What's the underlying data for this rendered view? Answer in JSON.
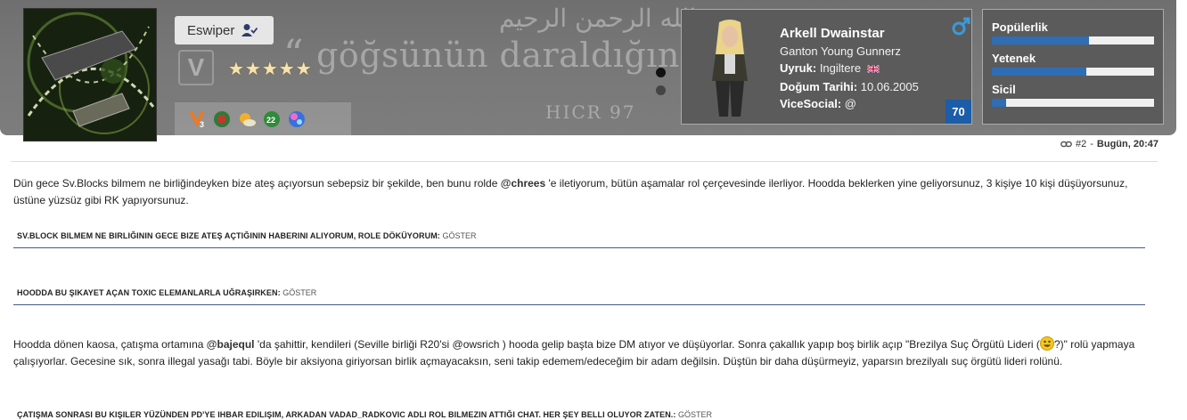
{
  "banner": {
    "quote_text": "göğsünün daraldığını biliyoruz",
    "open_quote": "“",
    "arabic_text": "بسم الله الرحمن الرحيم",
    "verse_ref": "HICR  97",
    "logo_letter": "V"
  },
  "profile": {
    "username": "Eswiper",
    "stars": "★★★★★"
  },
  "character": {
    "name": "Arkell Dwainstar",
    "gang": "Ganton Young Gunnerz",
    "nationality_label": "Uyruk:",
    "nationality_value": "Ingiltere",
    "birth_label": "Doğum Tarihi:",
    "birth_value": "10.06.2005",
    "social_label": "ViceSocial:",
    "social_value": "@",
    "level": "70"
  },
  "stats": [
    {
      "label": "Popülerlik",
      "value": 0.6
    },
    {
      "label": "Yetenek",
      "value": 0.58
    },
    {
      "label": "Sicil",
      "value": 0.09
    }
  ],
  "post_meta": {
    "number": "#2",
    "separator": " - ",
    "time": "Bugün, 20:47"
  },
  "content": {
    "p1_a": "Dün gece Sv.Blocks bilmem ne birliğindeyken bize ateş açıyorsun sebepsiz bir şekilde, ben bunu rolde ",
    "p1_mention": "@chrees",
    "p1_b": " 'e iletiyorum, bütün aşamalar rol çerçevesinde ilerliyor. Hoodda beklerken yine geliyorsunuz, 3 kişiye 10 kişi düşüyorsunuz, üstüne yüzsüz gibi RK yapıyorsunuz.",
    "spoiler1_title": "SV.BLOCK BILMEM NE BIRLIĞININ GECE BIZE ATEŞ AÇTIĞININ HABERINI ALIYORUM, ROLE DÖKÜYORUM:",
    "spoiler2_title": "HOODDA BU ŞIKAYET AÇAN TOXIC ELEMANLARLA UĞRAŞIRKEN:",
    "spoiler_toggle": "GÖSTER",
    "p2_a": "Hoodda dönen kaosa, çatışma ortamına ",
    "p2_mention": "@bajequl",
    "p2_b": " 'da şahittir, kendileri (Seville birliği R20'si @owsrich ) hooda gelip başta bize DM atıyor ve düşüyorlar. Sonra çakallık yapıp boş birlik açıp \"Brezilya Suç Örgütü Lideri (",
    "p2_c": "?)\" rolü yapmaya çalışıyorlar. Gecesine sık, sonra illegal yasağı tabi. Böyle bir aksiyona giriyorsan birlik açmayacaksın, seni takip edemem/edeceğim bir adam değilsin. Düştün bir daha düşürmeyiz, yaparsın brezilyalı suç örgütü lideri rolünü.",
    "spoiler3_title": "ÇATIŞMA SONRASI BU KIŞILER YÜZÜNDEN PD'YE IHBAR EDILIŞIM, ARKADAN VADAD_RADKOVIC ADLI ROL BILMEZIN ATTIĞI CHAT. HER ŞEY BELLI OLUYOR ZATEN.:"
  },
  "colors": {
    "banner": "#777777",
    "card": "#5b5b5b",
    "accent": "#2f6db5",
    "level_badge": "#1b5da8",
    "spoiler_rule": "#445a8a"
  }
}
